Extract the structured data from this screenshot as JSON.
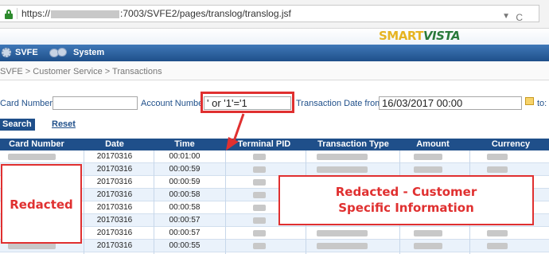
{
  "browser": {
    "url_prefix": "https://",
    "url_suffix": ":7003/SVFE2/pages/translog/translog.jsf",
    "reload_glyph": "C",
    "dropdown_glyph": "▼"
  },
  "brand": {
    "logo_part1": "SMART",
    "logo_part2": "VISTA"
  },
  "menu": {
    "items": [
      {
        "label": "SVFE",
        "icon": "gear-icon"
      },
      {
        "label": "System",
        "icon": "system-icon"
      }
    ]
  },
  "breadcrumb": "SVFE > Customer Service > Transactions",
  "filters": {
    "card_number_label": "Card Number:",
    "card_number_value": "",
    "account_number_label": "Account Number",
    "account_number_value": "' or '1'='1",
    "transaction_date_from_label": "Transaction Date from:",
    "transaction_date_from_value": "16/03/2017 00:00",
    "to_label": "to:"
  },
  "actions": {
    "search_label": "Search",
    "reset_label": "Reset"
  },
  "table": {
    "columns": [
      "Card Number",
      "Date",
      "Time",
      "Terminal PID",
      "Transaction Type",
      "Amount",
      "Currency"
    ],
    "rows": [
      {
        "date": "20170316",
        "time": "00:01:00"
      },
      {
        "date": "20170316",
        "time": "00:00:59"
      },
      {
        "date": "20170316",
        "time": "00:00:59"
      },
      {
        "date": "20170316",
        "time": "00:00:58"
      },
      {
        "date": "20170316",
        "time": "00:00:58"
      },
      {
        "date": "20170316",
        "time": "00:00:57"
      },
      {
        "date": "20170316",
        "time": "00:00:57"
      },
      {
        "date": "20170316",
        "time": "00:00:55"
      }
    ]
  },
  "annotations": {
    "redacted_left": "Redacted",
    "redacted_right": "Redacted - Customer Specific Information",
    "color": "#e03030"
  },
  "colors": {
    "header_blue": "#1f4f8a",
    "row_alt": "#eaf2fb",
    "logo_gold": "#e6b422",
    "logo_green": "#2a7a3b"
  }
}
